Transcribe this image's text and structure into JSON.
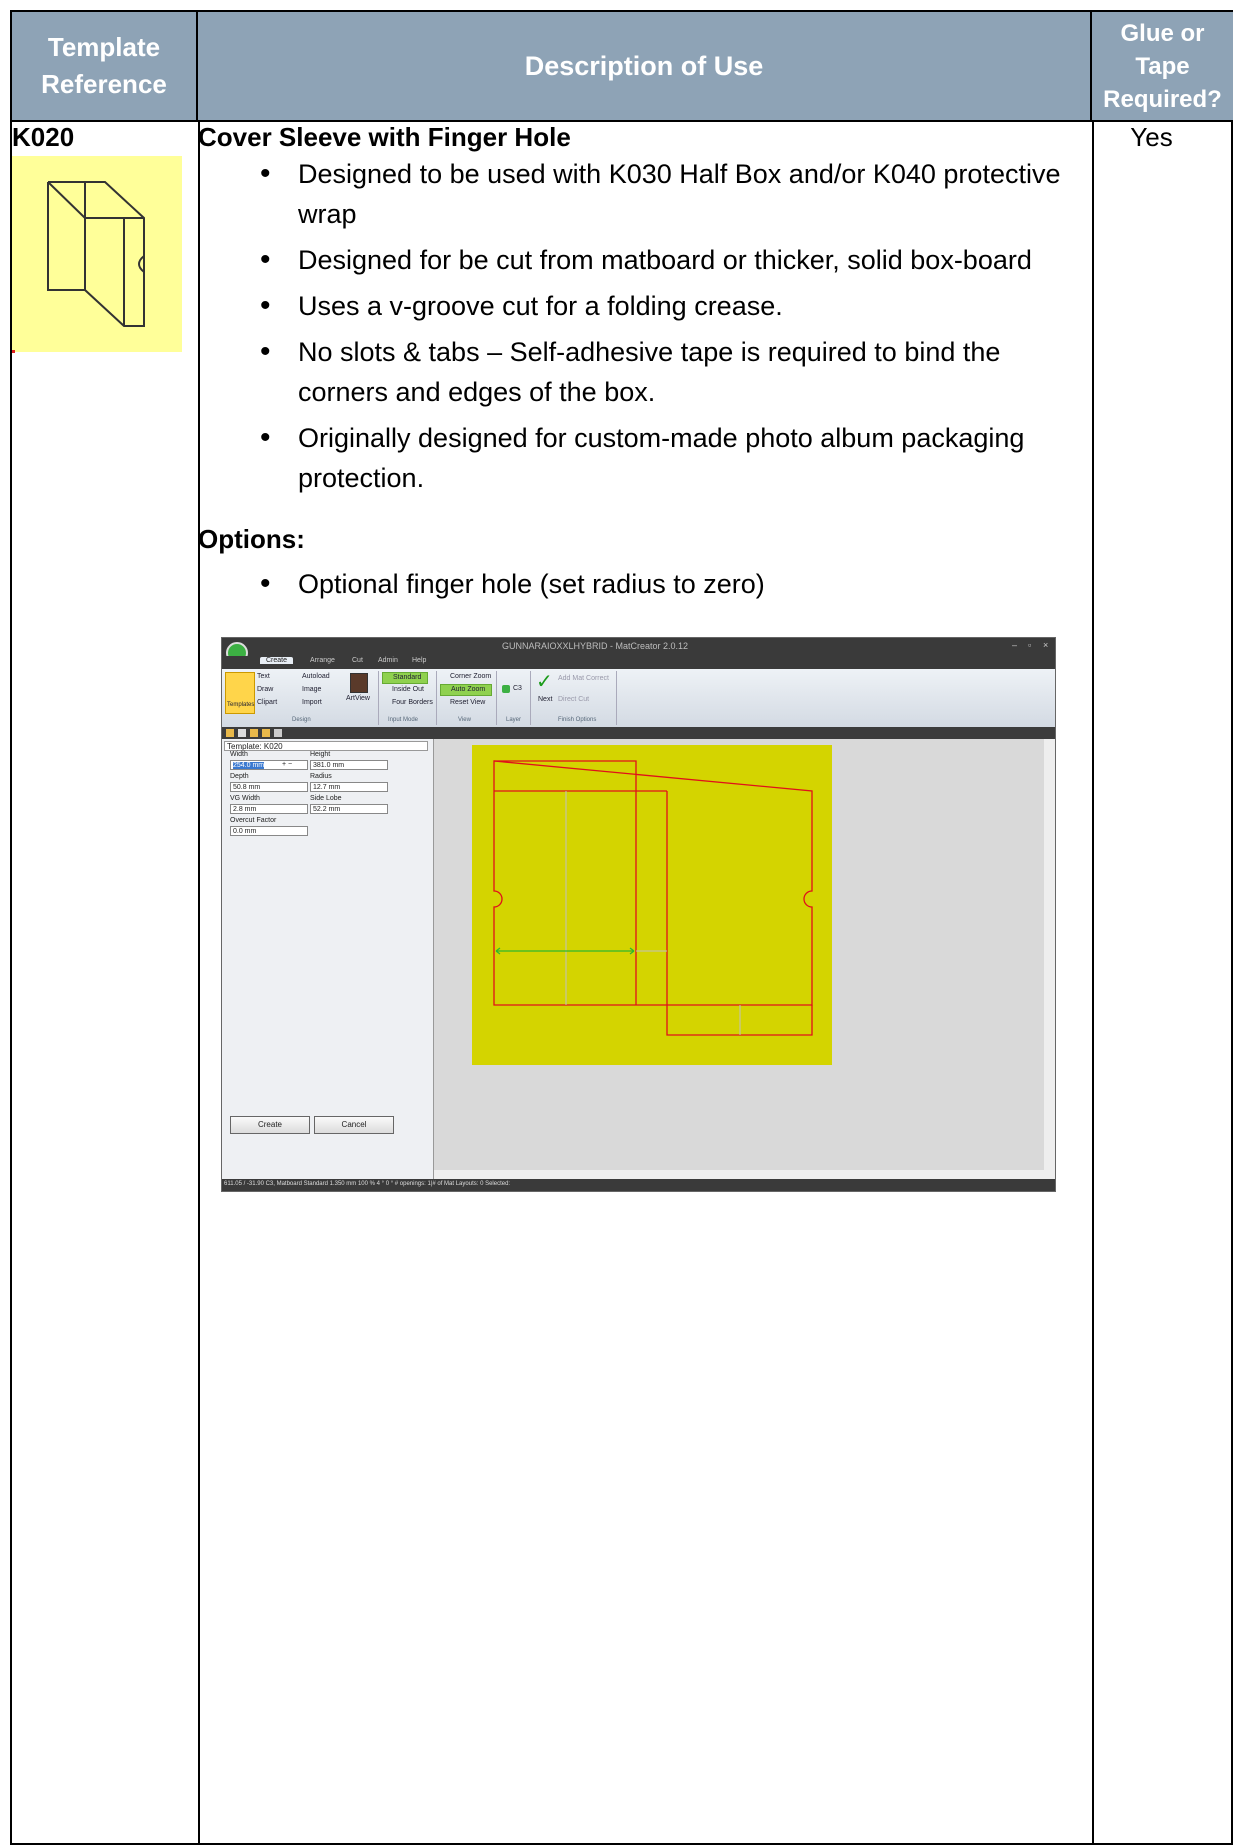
{
  "header": {
    "col1": "Template Reference",
    "col2": "Description of Use",
    "col3": "Glue or Tape Required?"
  },
  "row": {
    "reference": "K020",
    "title": "Cover Sleeve with Finger Hole",
    "bullets": [
      "Designed to be used with K030 Half Box and/or K040 protective wrap",
      "Designed for be cut from matboard or thicker, solid box-board",
      "Uses a v-groove cut for a folding crease.",
      "No slots & tabs – Self-adhesive tape is required to bind the corners and edges of the box.",
      "Originally designed for custom-made photo album packaging protection."
    ],
    "options_title": "Options:",
    "options": [
      "Optional finger hole (set radius to zero)"
    ],
    "glue": "Yes"
  },
  "app": {
    "title": "GUNNARAIOXXLHYBRID - MatCreator 2.0.12",
    "menu": [
      "Create",
      "Arrange",
      "Cut",
      "Admin",
      "Help"
    ],
    "ribbon": {
      "templates": "Templates",
      "text": "Text",
      "autoload": "Autoload",
      "draw": "Draw",
      "image": "Image",
      "clipart": "Clipart",
      "import": "Import",
      "artview": "ArtView",
      "standard": "Standard",
      "inside_out": "Inside Out",
      "four_borders": "Four Borders",
      "corner_zoom": "Corner Zoom",
      "auto_zoom": "Auto Zoom",
      "reset_view": "Reset View",
      "layer": "C3",
      "next": "Next",
      "add_mat": "Add Mat Correct",
      "direct_cut": "Direct Cut",
      "groups": [
        "Design",
        "Input Mode",
        "View",
        "Layer",
        "Finish Options"
      ]
    },
    "panel": {
      "template": "Template: K020",
      "width_label": "Width",
      "width_value": "254.0 mm",
      "height_label": "Height",
      "height_value": "381.0 mm",
      "depth_label": "Depth",
      "depth_value": "50.8 mm",
      "radius_label": "Radius",
      "radius_value": "12.7 mm",
      "vg_label": "VG Width",
      "vg_value": "2.8 mm",
      "side_label": "Side Lobe",
      "side_value": "52.2 mm",
      "overcut_label": "Overcut Factor",
      "overcut_value": "0.0 mm",
      "create": "Create",
      "cancel": "Cancel"
    },
    "status": "611.05 / -31.90     C3, Matboard Standard   1.350 mm   100 %   4 °   0 °   # openings:  1|# of Mat Layouts: 0   Selected:",
    "colors": {
      "canvas": "#d4d400",
      "cut_line": "#e0101a",
      "dimension": "#2eb82e"
    }
  }
}
